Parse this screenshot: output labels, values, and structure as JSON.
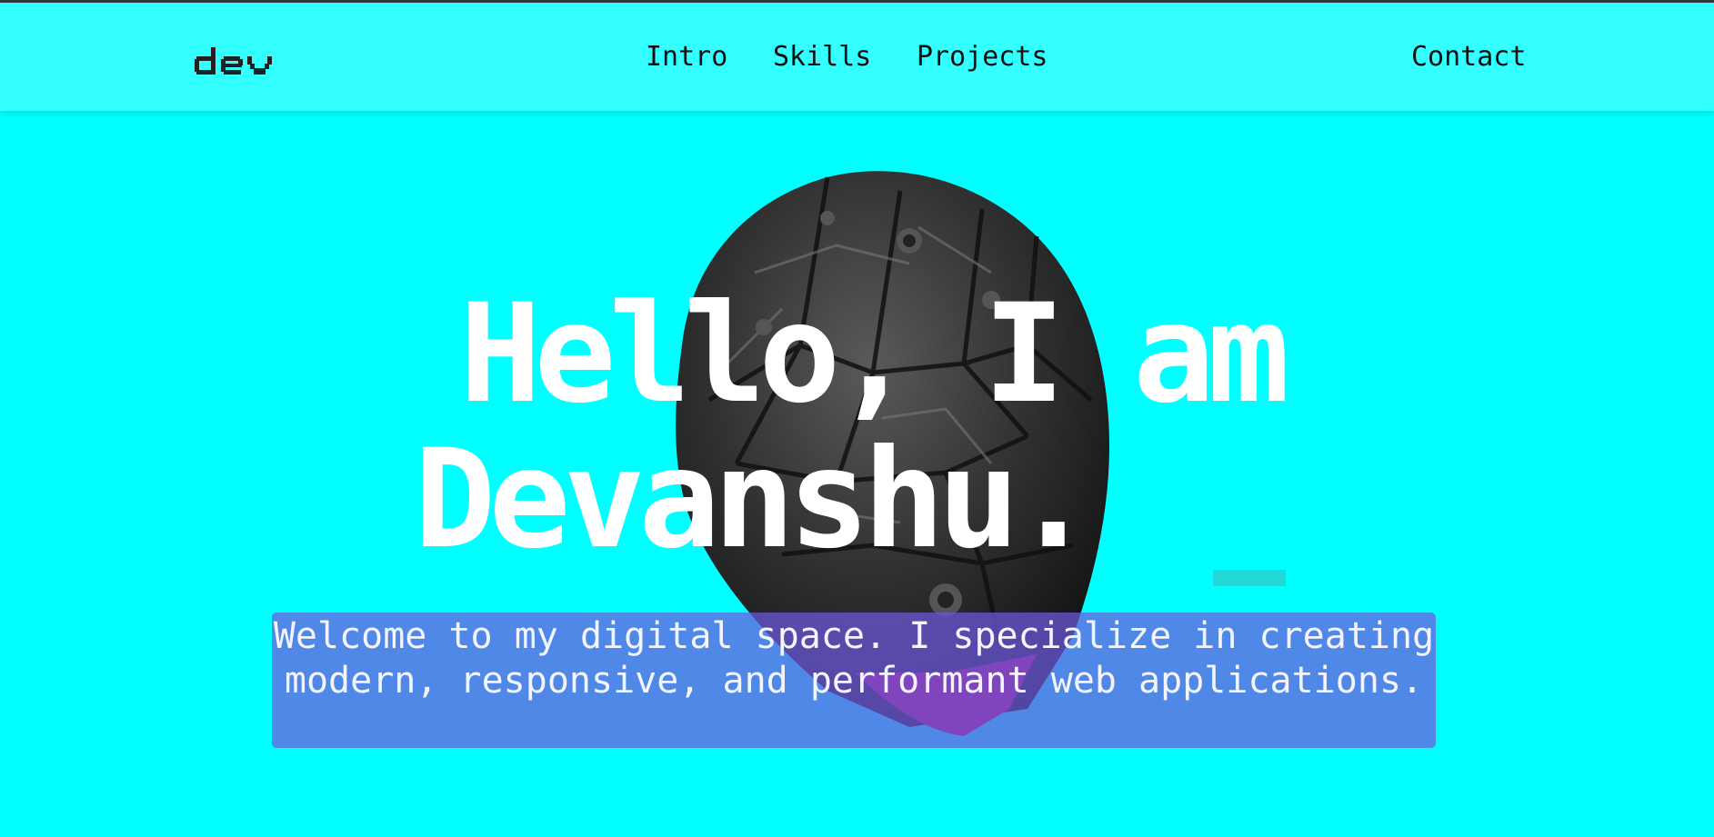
{
  "colors": {
    "background": "#00ffff",
    "navbar": "#33ffff",
    "hero_text": "#ffffff",
    "intro_box": "#6e5adc"
  },
  "navbar": {
    "logo": "dev",
    "links": [
      {
        "label": "Intro"
      },
      {
        "label": "Skills"
      },
      {
        "label": "Projects"
      }
    ],
    "contact": "Contact"
  },
  "hero": {
    "image_icon": "robot-head-image",
    "title_line1": "Hello, I am",
    "title_line2": "Devanshu.",
    "intro": "Welcome to my digital space. I specialize in creating modern, responsive, and performant web applications."
  }
}
